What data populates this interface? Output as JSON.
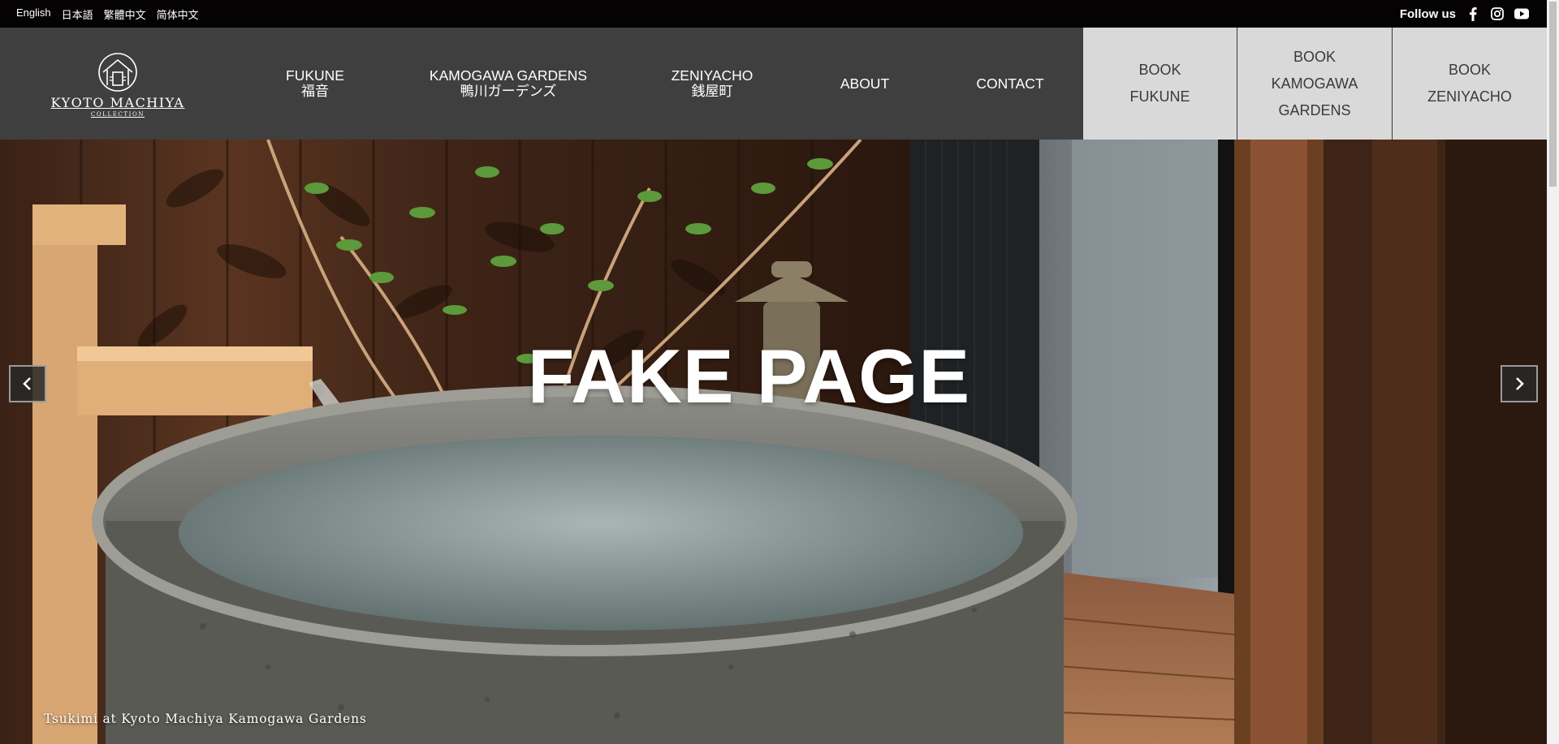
{
  "languages": [
    "English",
    "日本語",
    "繁體中文",
    "简体中文"
  ],
  "follow_us": "Follow us",
  "social_icons": [
    "facebook-icon",
    "instagram-icon",
    "youtube-icon"
  ],
  "logo": {
    "name": "KYOTO MACHIYA",
    "sub": "COLLECTION"
  },
  "nav": [
    {
      "label": "FUKUNE",
      "jp": "福音"
    },
    {
      "label": "KAMOGAWA GARDENS",
      "jp": "鴨川ガーデンズ"
    },
    {
      "label": "ZENIYACHO",
      "jp": "銭屋町"
    },
    {
      "label": "ABOUT",
      "jp": ""
    },
    {
      "label": "CONTACT",
      "jp": ""
    }
  ],
  "book_buttons": [
    {
      "line1": "BOOK",
      "line2": "FUKUNE",
      "line3": ""
    },
    {
      "line1": "BOOK",
      "line2": "KAMOGAWA",
      "line3": "GARDENS"
    },
    {
      "line1": "BOOK",
      "line2": "ZENIYACHO",
      "line3": ""
    }
  ],
  "hero": {
    "title": "FAKE PAGE",
    "caption": "Tsukimi at Kyoto Machiya Kamogawa Gardens"
  },
  "colors": {
    "topbar": "#050203",
    "header": "#3f3f3f",
    "book_bg": "#d9d9d9"
  }
}
